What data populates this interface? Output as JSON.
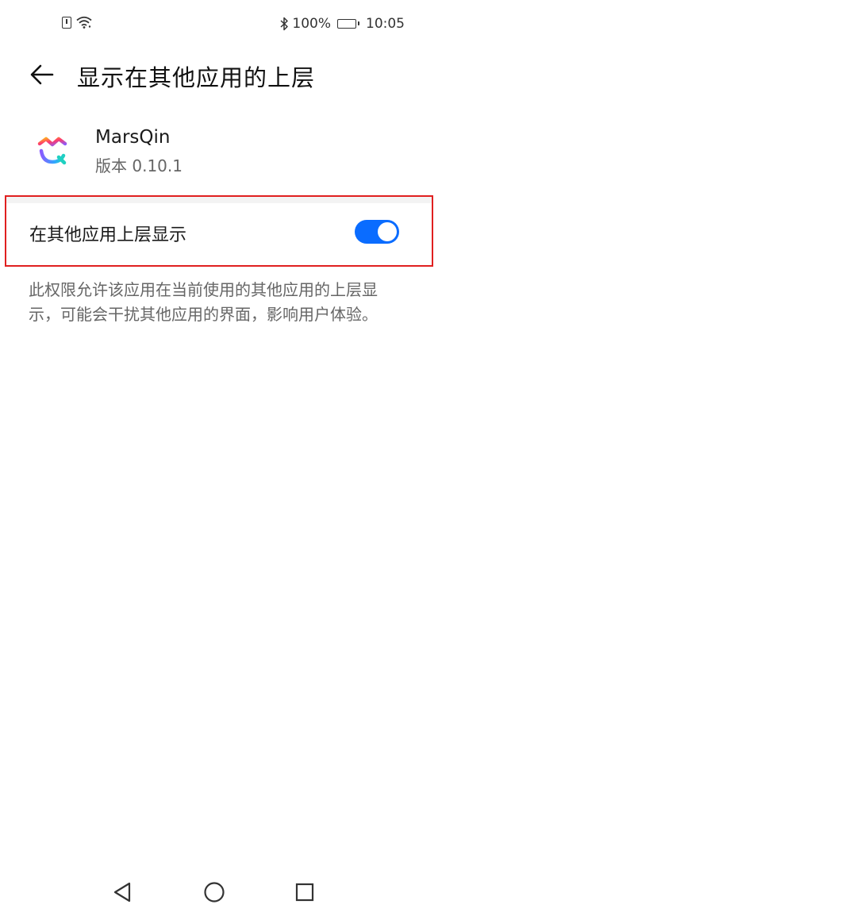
{
  "status_bar": {
    "battery_text": "100%",
    "time": "10:05",
    "icons": [
      "sim-alert-icon",
      "wifi-icon",
      "bluetooth-icon",
      "battery-icon"
    ]
  },
  "header": {
    "title": "显示在其他应用的上层",
    "back_icon": "back-arrow-icon"
  },
  "app": {
    "name": "MarsQin",
    "version": "版本 0.10.1",
    "logo_icon": "marsqin-logo"
  },
  "permission": {
    "label": "在其他应用上层显示",
    "enabled": true,
    "accent_color": "#0a6cff",
    "highlight_color": "#e02020"
  },
  "description": "此权限允许该应用在当前使用的其他应用的上层显示，可能会干扰其他应用的界面，影响用户体验。",
  "nav_bar": {
    "buttons": [
      "back-triangle-icon",
      "home-circle-icon",
      "recents-square-icon"
    ]
  }
}
